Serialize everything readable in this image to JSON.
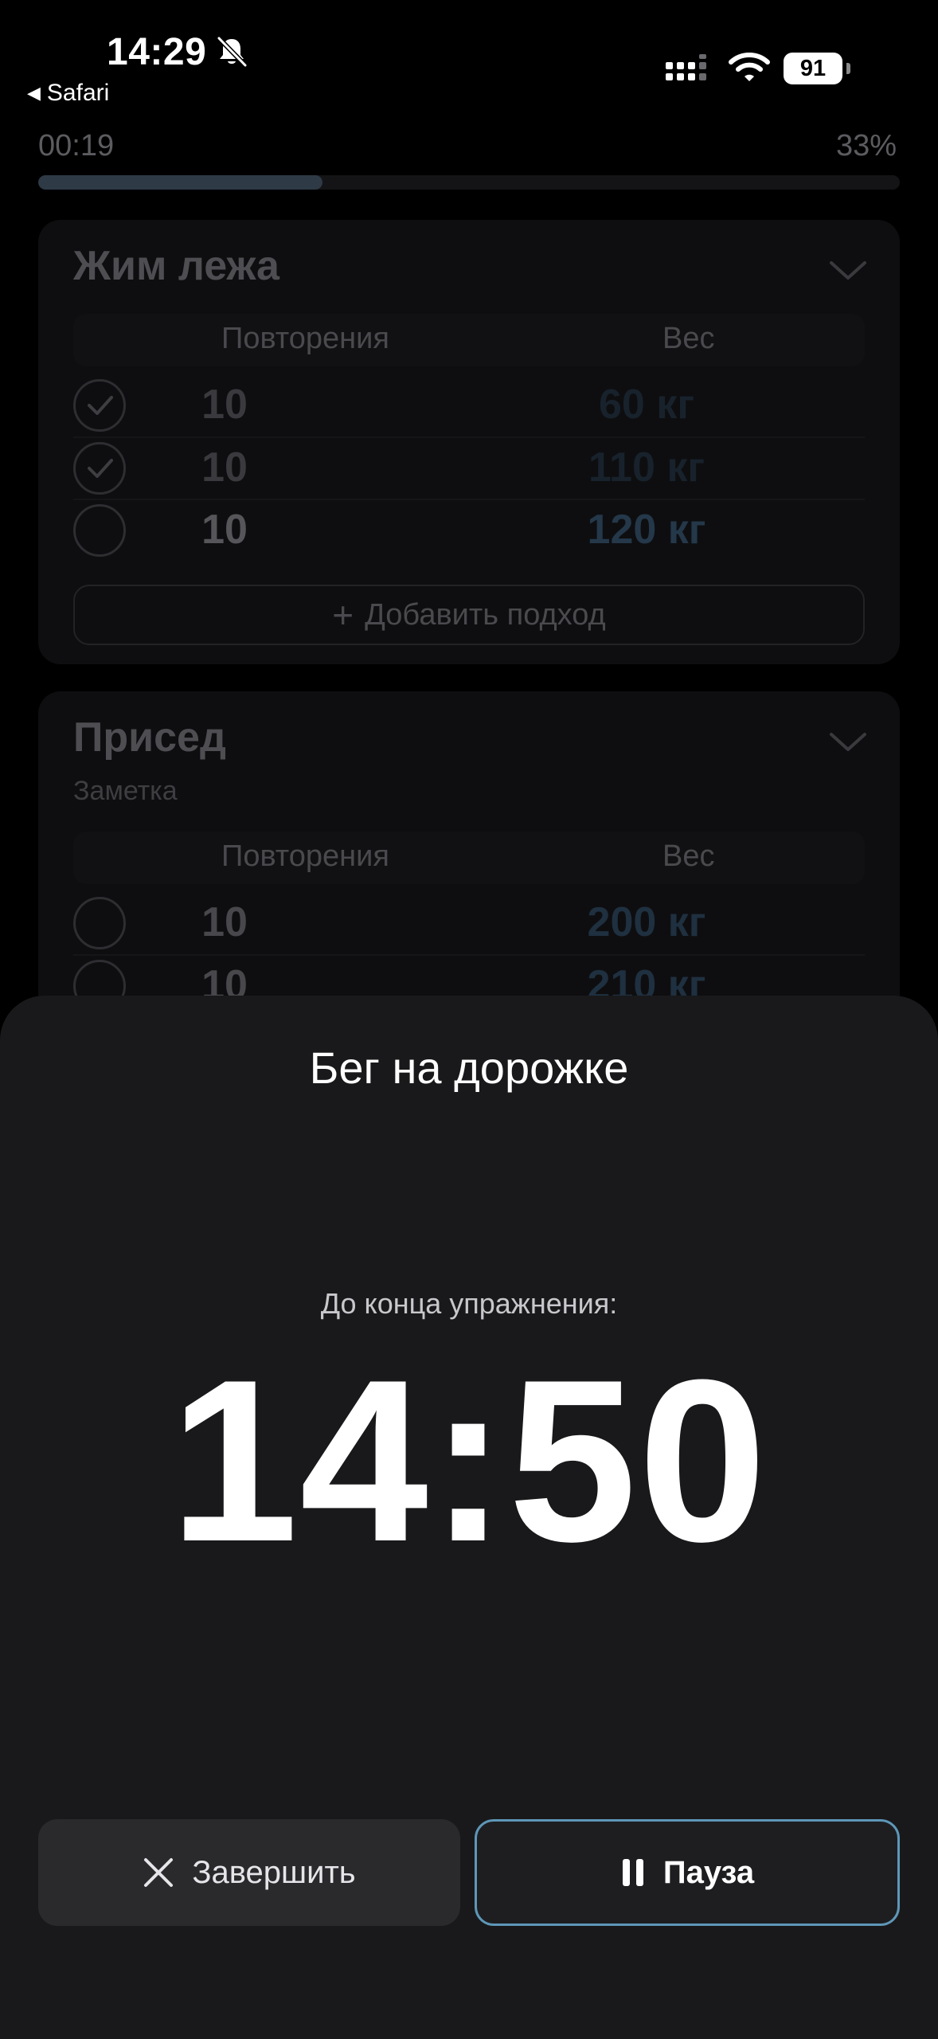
{
  "status_bar": {
    "time": "14:29",
    "back_app": "Safari",
    "battery": "91"
  },
  "workout": {
    "elapsed": "00:19",
    "progress_percent_label": "33%",
    "progress_fraction": 0.33,
    "add_set_label": "Добавить подход",
    "columns": {
      "reps": "Повторения",
      "weight": "Вес"
    },
    "exercises": [
      {
        "name": "Жим лежа",
        "sets": [
          {
            "reps": "10",
            "weight": "60 кг",
            "done": true
          },
          {
            "reps": "10",
            "weight": "110 кг",
            "done": true
          },
          {
            "reps": "10",
            "weight": "120 кг",
            "done": false
          }
        ]
      },
      {
        "name": "Присед",
        "note": "Заметка",
        "sets": [
          {
            "reps": "10",
            "weight": "200 кг",
            "done": false
          },
          {
            "reps": "10",
            "weight": "210 кг",
            "done": false
          }
        ]
      }
    ]
  },
  "sheet": {
    "title": "Бег на дорожке",
    "remaining_label": "До конца упражнения:",
    "timer": "14:50",
    "finish_button": "Завершить",
    "pause_button": "Пауза",
    "accent_color": "#5e97b8"
  }
}
